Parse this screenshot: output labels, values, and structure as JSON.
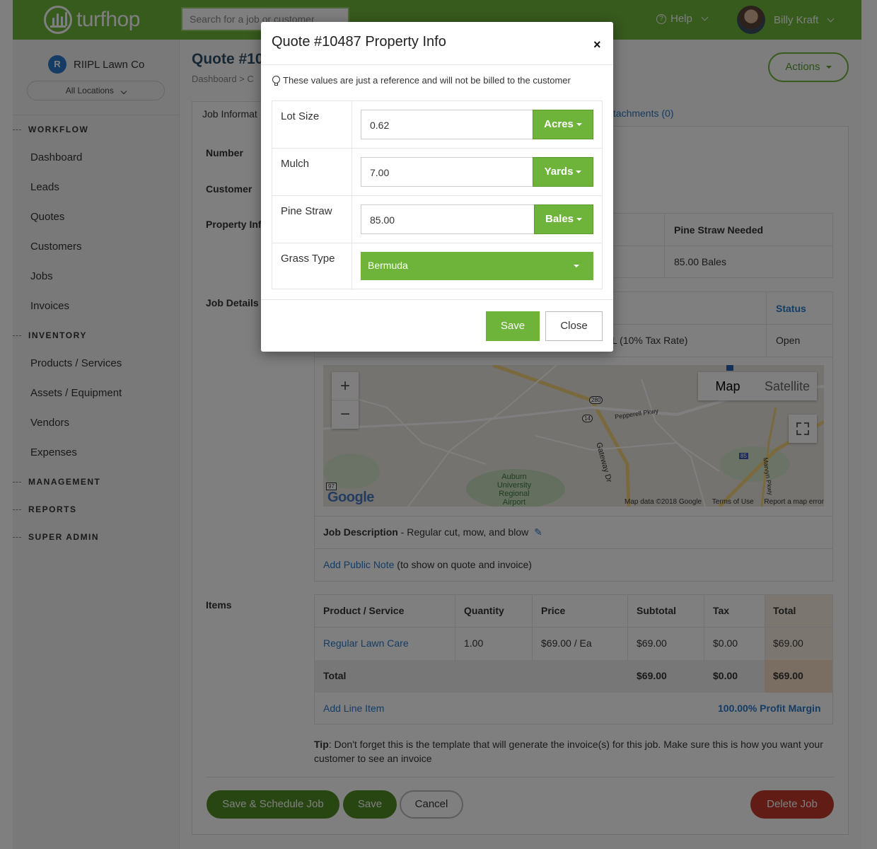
{
  "topbar": {
    "logo": "turfhop",
    "search_placeholder": "Search for a job or customer",
    "help_label": "Help",
    "user_name": "Billy Kraft"
  },
  "sidebar": {
    "company": "RIIPL Lawn Co",
    "company_initial": "R",
    "locations": "All Locations",
    "sections": {
      "workflow": "WORKFLOW",
      "inventory": "INVENTORY",
      "management": "MANAGEMENT",
      "reports": "REPORTS",
      "super_admin": "SUPER ADMIN"
    },
    "workflow_items": [
      "Dashboard",
      "Leads",
      "Quotes",
      "Customers",
      "Jobs",
      "Invoices"
    ],
    "inventory_items": [
      "Products / Services",
      "Assets / Equipment",
      "Vendors",
      "Expenses"
    ]
  },
  "main": {
    "title": "Quote #10",
    "breadcrumb": "Dashboard  >  C",
    "actions_label": "Actions",
    "tab_active": "Job Informat",
    "tab_attachments": "ttachments (0)",
    "labels": {
      "number": "Number",
      "customer": "Customer",
      "property_info": "Property Inf",
      "job_details": "Job Details",
      "items": "Items"
    },
    "property_table": {
      "header": "Pine Straw Needed",
      "value": "85.00 Bales"
    },
    "job_details_table": {
      "status_header": "Status",
      "tax_text": "L (10% Tax Rate)",
      "status_value": "Open"
    },
    "map": {
      "zoom_in": "+",
      "zoom_out": "−",
      "type_map": "Map",
      "type_satellite": "Satellite",
      "google": "Google",
      "map_data": "Map data ©2018 Google",
      "terms": "Terms of Use",
      "report": "Report a map error",
      "poi_label": "Auburn University Regional Airport",
      "road_gateway": "Gateway Dr",
      "road_pepperell": "Pepperell Pkwy",
      "road_marvyn": "Marvyn Pkwy",
      "shield_280": "280",
      "shield_14": "14",
      "shield_85": "85",
      "shield_97": "97"
    },
    "job_description_label": "Job Description",
    "job_description_value": " - Regular cut, mow, and blow",
    "add_public_note": "Add Public Note",
    "public_note_suffix": " (to show on quote and invoice)",
    "items_table": {
      "headers": [
        "Product / Service",
        "Quantity",
        "Price",
        "Subtotal",
        "Tax",
        "Total"
      ],
      "row": [
        "Regular Lawn Care",
        "1.00",
        "$69.00 / Ea",
        "$69.00",
        "$0.00",
        "$69.00"
      ],
      "total_label": "Total",
      "total_subtotal": "$69.00",
      "total_tax": "$0.00",
      "total_total": "$69.00",
      "add_line_item": "Add Line Item",
      "profit_margin": "100.00% Profit Margin"
    },
    "tip_label": "Tip",
    "tip_text": ": Don't forget this is the template that will generate the invoice(s) for this job. Make sure this is how you want your customer to see an invoice",
    "buttons": {
      "save_schedule": "Save & Schedule Job",
      "save": "Save",
      "cancel": "Cancel",
      "delete": "Delete Job"
    }
  },
  "modal": {
    "title": "Quote #10487 Property Info",
    "close_x": "×",
    "note": "These values are just a reference and will not be billed to the customer",
    "rows": [
      {
        "label": "Lot Size",
        "value": "0.62",
        "unit": "Acres"
      },
      {
        "label": "Mulch",
        "value": "7.00",
        "unit": "Yards"
      },
      {
        "label": "Pine Straw",
        "value": "85.00",
        "unit": "Bales"
      }
    ],
    "grass_label": "Grass Type",
    "grass_value": "Bermuda",
    "save_label": "Save",
    "close_label": "Close"
  },
  "colors": {
    "brand_green": "#6eb43a",
    "link_blue": "#2a79c9",
    "delete_red": "#c0392b",
    "overlay": "rgba(0,0,0,0.5)"
  }
}
